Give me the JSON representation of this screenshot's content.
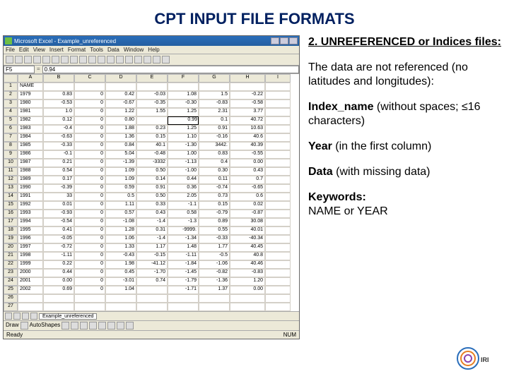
{
  "title": "CPT INPUT FILE FORMATS",
  "right": {
    "heading": "2. UNREFERENCED or Indices files:",
    "p1": "The data are not referenced (no latitudes and longitudes):",
    "idx_label": "Index_name",
    "idx_rest": "  (without spaces; ≤16 characters)",
    "year_label": "Year",
    "year_rest": " (in the first column)",
    "data_label": "Data",
    "data_rest": " (with missing data)",
    "kw_label": "Keywords:",
    "kw_val": "NAME or YEAR"
  },
  "excel": {
    "window_title": "Microsoft Excel - Example_unreferenced",
    "menus": [
      "File",
      "Edit",
      "View",
      "Insert",
      "Format",
      "Tools",
      "Data",
      "Window",
      "Help"
    ],
    "toolbar_count": 18,
    "cellref": "F5",
    "cellval": "0.94",
    "columns": [
      "A",
      "B",
      "C",
      "D",
      "E",
      "F",
      "G",
      "H",
      "I"
    ],
    "rows": [
      {
        "r": "1",
        "cells": [
          "NAME",
          "",
          "",
          "",
          "",
          "",
          "",
          "",
          ""
        ]
      },
      {
        "r": "2",
        "cells": [
          "1979",
          "0.83",
          "0",
          "0.42",
          "-0.03",
          "1.08",
          "1.5",
          "-0.22",
          ""
        ]
      },
      {
        "r": "3",
        "cells": [
          "1980",
          "-0.53",
          "0",
          "-0.67",
          "-0.35",
          "-0.30",
          "-0.83",
          "-0.58",
          ""
        ]
      },
      {
        "r": "4",
        "cells": [
          "1981",
          "1.0",
          "0",
          "1.22",
          "1.55",
          "1.25",
          "2.31",
          "3.77",
          ""
        ]
      },
      {
        "r": "5",
        "cells": [
          "1982",
          "0.12",
          "0",
          "0.80",
          "",
          "0.99",
          "0.1",
          "40.72",
          ""
        ]
      },
      {
        "r": "6",
        "cells": [
          "1983",
          "-0.4",
          "0",
          "1.88",
          "0.23",
          "1.25",
          "0.91",
          "10.63",
          ""
        ]
      },
      {
        "r": "7",
        "cells": [
          "1984",
          "-0.63",
          "0",
          "1.36",
          "0.15",
          "1.10",
          "-0.16",
          "40.6",
          ""
        ]
      },
      {
        "r": "8",
        "cells": [
          "1985",
          "-0.33",
          "0",
          "0.84",
          "40.1",
          "-1.30",
          "3442.",
          "40.39",
          ""
        ]
      },
      {
        "r": "9",
        "cells": [
          "1986",
          "-0.1",
          "0",
          "5.04",
          "-0.48",
          "1.00",
          "0.83",
          "-0.55",
          ""
        ]
      },
      {
        "r": "10",
        "cells": [
          "1987",
          "0.21",
          "0",
          "-1.39",
          "-3332",
          "-1.13",
          "0.4",
          "0.00",
          ""
        ]
      },
      {
        "r": "11",
        "cells": [
          "1988",
          "0.54",
          "0",
          "1.09",
          "0.50",
          "-1.00",
          "0.30",
          "0.43",
          ""
        ]
      },
      {
        "r": "12",
        "cells": [
          "1989",
          "0.17",
          "0",
          "1.09",
          "0.14",
          "0.44",
          "0.11",
          "0.7",
          ""
        ]
      },
      {
        "r": "13",
        "cells": [
          "1990",
          "-0.39",
          "0",
          "0.59",
          "0.91",
          "0.36",
          "-0.74",
          "-0.65",
          ""
        ]
      },
      {
        "r": "14",
        "cells": [
          "1991",
          "33",
          "0",
          "0.5",
          "0.50",
          "2.05",
          "0.73",
          "0.6",
          ""
        ]
      },
      {
        "r": "15",
        "cells": [
          "1992",
          "0.01",
          "0",
          "1.11",
          "0.33",
          "-1.1",
          "0.15",
          "0.02",
          ""
        ]
      },
      {
        "r": "16",
        "cells": [
          "1993",
          "-0.93",
          "0",
          "0.57",
          "0.43",
          "0.58",
          "-0.79",
          "-0.87",
          ""
        ]
      },
      {
        "r": "17",
        "cells": [
          "1994",
          "-0.54",
          "0",
          "-1.08",
          "-1.4",
          "-1.3",
          "0.89",
          "30.08",
          ""
        ]
      },
      {
        "r": "18",
        "cells": [
          "1995",
          "0.41",
          "0",
          "1.28",
          "0.31",
          "-9999.",
          "0.55",
          "40.01",
          ""
        ]
      },
      {
        "r": "19",
        "cells": [
          "1996",
          "-0.05",
          "0",
          "1.06",
          "-1.4",
          "-1.34",
          "-0.33",
          "-40.34",
          ""
        ]
      },
      {
        "r": "20",
        "cells": [
          "1997",
          "-0.72",
          "0",
          "1.33",
          "1.17",
          "1.48",
          "1.77",
          "40.45",
          ""
        ]
      },
      {
        "r": "21",
        "cells": [
          "1998",
          "-1.11",
          "0",
          "-0.43",
          "-0.15",
          "-1.11",
          "-0.5",
          "40.8",
          ""
        ]
      },
      {
        "r": "22",
        "cells": [
          "1999",
          "0.22",
          "0",
          "1.98",
          "-41.12",
          "-1.84",
          "-1.06",
          "40.46",
          ""
        ]
      },
      {
        "r": "23",
        "cells": [
          "2000",
          "0.44",
          "0",
          "0.45",
          "-1.70",
          "-1.45",
          "-0.82",
          "-0.83",
          ""
        ]
      },
      {
        "r": "24",
        "cells": [
          "2001",
          "0.00",
          "0",
          "-3.01",
          "0.74",
          "-1.79",
          "-1.36",
          "1.20",
          ""
        ]
      },
      {
        "r": "25",
        "cells": [
          "2002",
          "0.69",
          "0",
          "1.04",
          "",
          "-1.71",
          "1.37",
          "0.00",
          ""
        ]
      },
      {
        "r": "26",
        "cells": [
          "",
          "",
          "",
          "",
          "",
          "",
          "",
          "",
          ""
        ]
      },
      {
        "r": "27",
        "cells": [
          "",
          "",
          "",
          "",
          "",
          "",
          "",
          "",
          ""
        ]
      }
    ],
    "sheet_tab": "Example_unreferenced",
    "draw_label": "Draw",
    "autoshapes": "AutoShapes",
    "status_left": "Ready",
    "status_right": "NUM"
  },
  "logo_label": "IRI"
}
